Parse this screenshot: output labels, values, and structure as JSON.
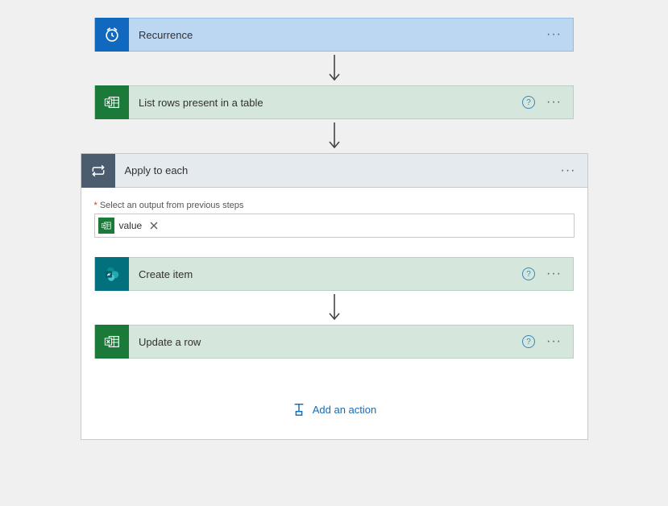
{
  "steps": {
    "recurrence": {
      "title": "Recurrence"
    },
    "listRows": {
      "title": "List rows present in a table"
    },
    "applyEach": {
      "title": "Apply to each",
      "fieldLabel": "Select an output from previous steps",
      "tokenLabel": "value"
    },
    "createItem": {
      "title": "Create item"
    },
    "updateRow": {
      "title": "Update a row"
    }
  },
  "addAction": "Add an action",
  "colors": {
    "blue": "#1068bf",
    "green": "#1b7a3a",
    "teal": "#03717d",
    "slate": "#4a5c6e",
    "link": "#0f6cbd"
  }
}
